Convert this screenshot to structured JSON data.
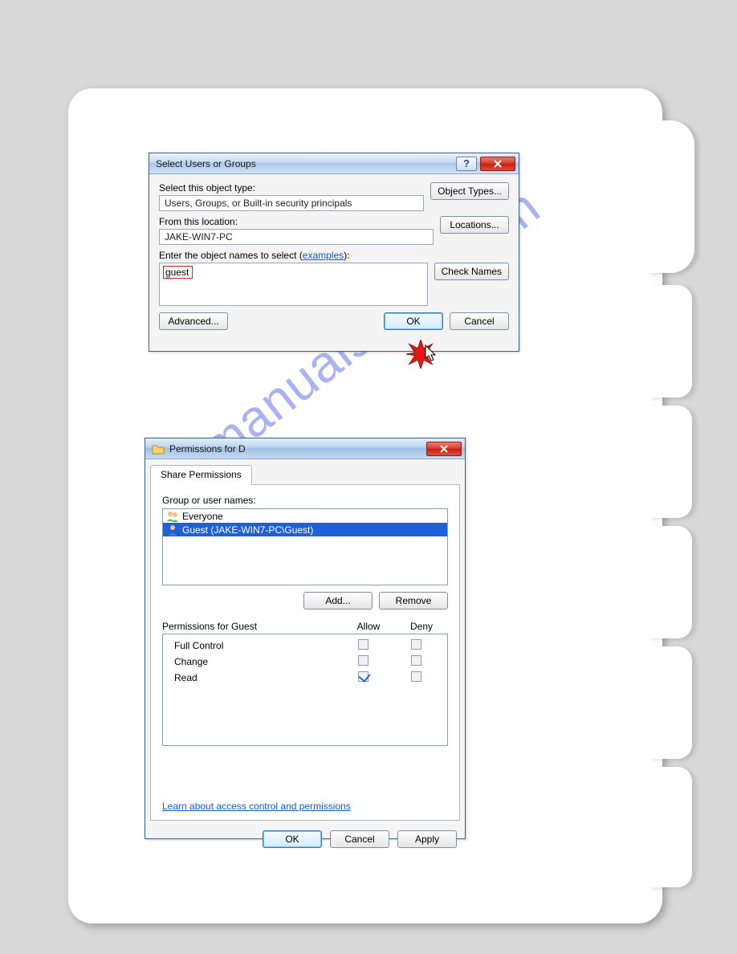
{
  "watermark": "manualshive.com",
  "dialog1": {
    "title": "Select Users or Groups",
    "object_type_label": "Select this object type:",
    "object_type_value": "Users, Groups, or Built-in security principals",
    "object_types_btn": "Object Types...",
    "location_label": "From this location:",
    "location_value": "JAKE-WIN7-PC",
    "locations_btn": "Locations...",
    "names_label_prefix": "Enter the object names to select (",
    "examples_link": "examples",
    "names_label_suffix": "):",
    "names_value": "guest",
    "check_names_btn": "Check Names",
    "advanced_btn": "Advanced...",
    "ok_btn": "OK",
    "cancel_btn": "Cancel"
  },
  "dialog2": {
    "title": "Permissions for D",
    "tab_label": "Share Permissions",
    "group_label": "Group or user names:",
    "items": [
      {
        "name": "Everyone"
      },
      {
        "name": "Guest (JAKE-WIN7-PC\\Guest)"
      }
    ],
    "add_btn": "Add...",
    "remove_btn": "Remove",
    "perm_for_label": "Permissions for Guest",
    "col_allow": "Allow",
    "col_deny": "Deny",
    "perms": [
      {
        "label": "Full Control",
        "allow": false,
        "deny": false
      },
      {
        "label": "Change",
        "allow": false,
        "deny": false
      },
      {
        "label": "Read",
        "allow": true,
        "deny": false
      }
    ],
    "learn_link": "Learn about access control and permissions",
    "ok_btn": "OK",
    "cancel_btn": "Cancel",
    "apply_btn": "Apply"
  }
}
